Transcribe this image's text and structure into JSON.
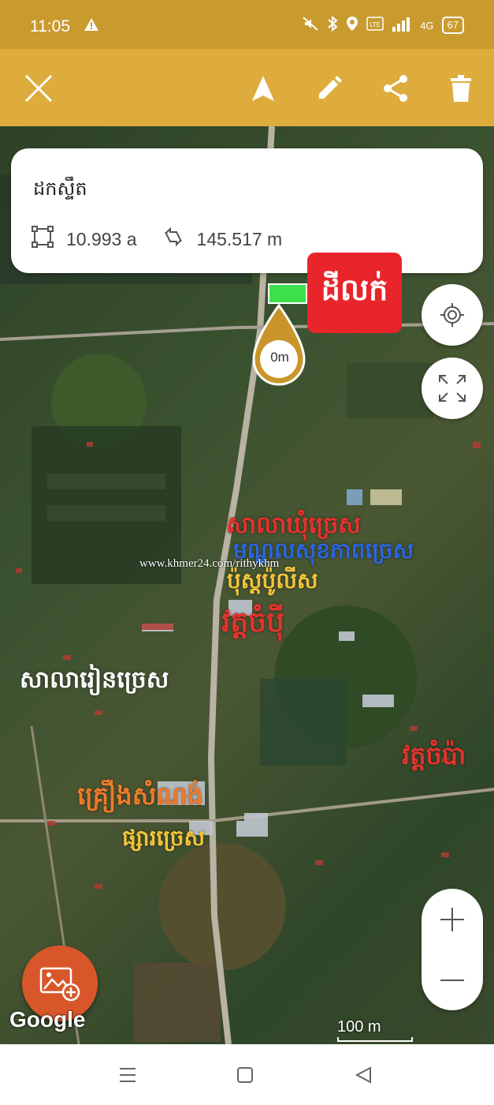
{
  "status_bar": {
    "time": "11:05",
    "battery": "67",
    "network": "4G",
    "icons": [
      "warning-icon",
      "mute-icon",
      "bluetooth-icon",
      "location-icon",
      "volte-icon",
      "signal-icon",
      "battery-icon"
    ]
  },
  "toolbar": {
    "icons": [
      "close-icon",
      "navigate-icon",
      "edit-icon",
      "share-icon",
      "delete-icon"
    ],
    "background": "#deac3c"
  },
  "info_card": {
    "title": "ដកស្ទឹត",
    "area_value": "10.993 a",
    "distance_value": "145.517 m"
  },
  "map": {
    "red_label": "ដីលក់",
    "pin_label": "0m",
    "labels": [
      {
        "text": "សាលាឃុំច្រេស",
        "color": "#e5322d"
      },
      {
        "text": "មណ្ឌលសុខភាពច្រេស",
        "color": "#2b66e0"
      },
      {
        "text": "ប៉ុស្តប៉ូលីស",
        "color": "#f2c33a"
      },
      {
        "text": "វត្តចំប៉ី",
        "color": "#e5322d"
      },
      {
        "text": "សាលារៀនច្រេស",
        "color": "#ffffff"
      },
      {
        "text": "វត្តចំប៉ា",
        "color": "#e5322d"
      },
      {
        "text": "គ្រឿងសំណង់",
        "color": "#f07a2a"
      },
      {
        "text": "ផ្សារច្រេស",
        "color": "#f2c33a"
      }
    ],
    "watermark": "www.khmer24.com/rithykhm",
    "google": "Google",
    "scale": "100 m"
  },
  "nav_bar": {
    "icons": [
      "recents-icon",
      "home-icon",
      "back-icon"
    ]
  }
}
